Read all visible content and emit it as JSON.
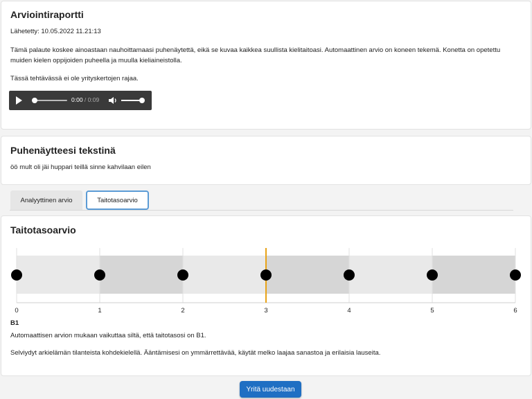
{
  "report": {
    "title": "Arviointiraportti",
    "sent": "Lähetetty: 10.05.2022 11.21:13",
    "paragraph1": "Tämä palaute koskee ainoastaan nauhoittamaasi puhenäytettä, eikä se kuvaa kaikkea suullista kielitaitoasi. Automaattinen arvio on koneen tekemä. Konetta on opetettu muiden kielen oppijoiden puheella ja muulla kieliaineistolla.",
    "paragraph2": "Tässä tehtävässä ei ole yrityskertojen rajaa.",
    "player": {
      "current": "0:00",
      "duration": " / 0:09",
      "play_icon": "play-icon",
      "volume_icon": "volume-icon",
      "progress": 0,
      "volume": 1
    }
  },
  "transcript": {
    "title": "Puhenäytteesi tekstinä",
    "text": "öö mult oli jäi huppari teillä sinne kahvilaan eilen"
  },
  "tabs": [
    {
      "label": "Analyyttinen arvio",
      "active": false
    },
    {
      "label": "Taitotasoarvio",
      "active": true
    }
  ],
  "level": {
    "title": "Taitotasoarvio",
    "scale_ticks": [
      "0",
      "1",
      "2",
      "3",
      "4",
      "5",
      "6"
    ],
    "scale_min": 0,
    "scale_max": 6,
    "marker_value": 3,
    "marker_color": "#e8a317",
    "band_colors": [
      "#e9e9e9",
      "#d6d6d6"
    ],
    "result_label": "B1",
    "result_text": "Automaattisen arvion mukaan vaikuttaa siltä, että taitotasosi on B1.",
    "description": "Selviydyt arkielämän tilanteista kohdekielellä. Ääntämisesi on ymmärrettävää, käytät melko laajaa sanastoa ja erilaisia lauseita."
  },
  "retry_button": "Yritä uudestaan"
}
